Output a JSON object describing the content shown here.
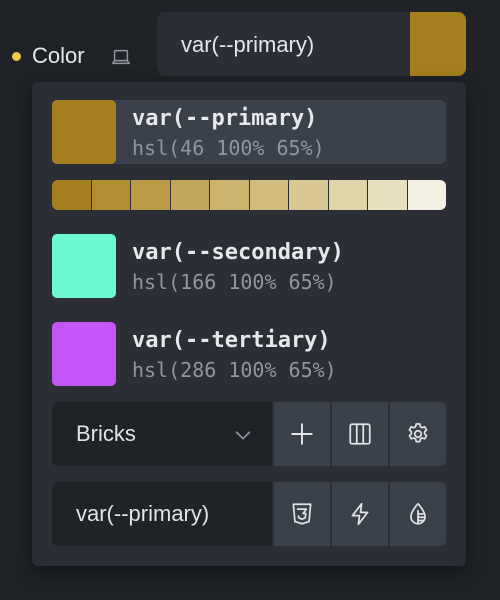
{
  "control": {
    "label": "Color",
    "value": "var(--primary)",
    "swatch_color": "#a57e1e",
    "modified_dot_color": "#f2c94c"
  },
  "variables": [
    {
      "name": "var(--primary)",
      "hsl": "hsl(46 100% 65%)",
      "color": "#a57e1e",
      "active": true
    },
    {
      "name": "var(--secondary)",
      "hsl": "hsl(166 100% 65%)",
      "color": "#6bfad2"
    },
    {
      "name": "var(--tertiary)",
      "hsl": "hsl(286 100% 65%)",
      "color": "#c455f7"
    }
  ],
  "shades": [
    "#a57e1e",
    "#b08e32",
    "#bb9b45",
    "#c3a659",
    "#ccb46e",
    "#d2bd7f",
    "#d9c794",
    "#e1d4a8",
    "#e8dfbf",
    "#f4efe3"
  ],
  "palette_select": {
    "value": "Bricks",
    "icons": [
      "plus-icon",
      "columns-icon",
      "gear-icon"
    ]
  },
  "raw_input": {
    "value": "var(--primary)",
    "icons": [
      "css3-icon",
      "lightning-icon",
      "drop-icon"
    ]
  }
}
